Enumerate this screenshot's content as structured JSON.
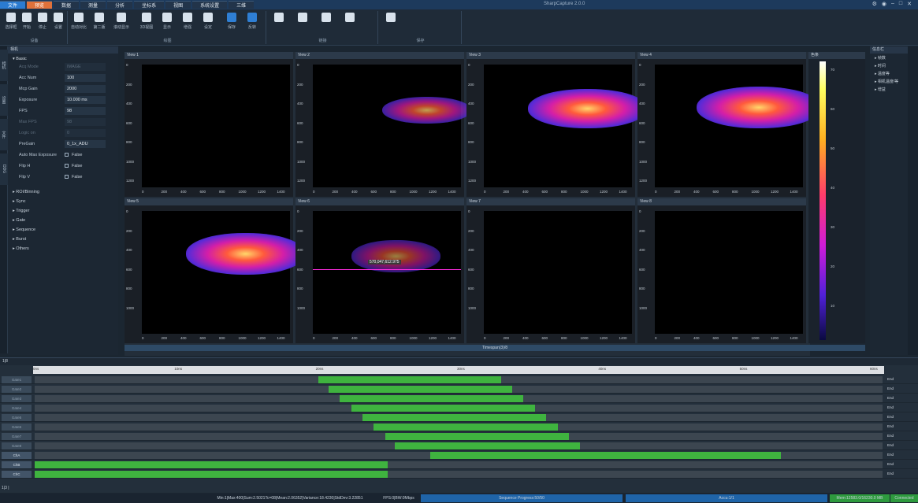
{
  "title_bar": {
    "tabs": [
      "文件",
      "预览",
      "数据",
      "测量",
      "分析",
      "坐标系",
      "视图",
      "系统设置",
      "三维"
    ],
    "app_title": "SharpCapture 2.0.0"
  },
  "ribbon": {
    "buttons": [
      "选择框",
      "开始",
      "停止",
      "设置",
      "自动对比",
      "第二版",
      "滚动显示",
      "3D视图",
      "显示",
      "增强",
      "设定",
      "保存",
      "反转"
    ],
    "groups": [
      "设备",
      "绘图",
      "链接",
      "保存"
    ]
  },
  "left_panel": {
    "header": "相机",
    "section": "Basic",
    "props": [
      {
        "key": "Acq Mode",
        "val": "IMAGE",
        "dim": true
      },
      {
        "key": "Acc Num",
        "val": "100",
        "dim": false
      },
      {
        "key": "Mcp Gain",
        "val": "2000",
        "dim": false
      },
      {
        "key": "Exposure",
        "val": "10.000  ms",
        "dim": false
      },
      {
        "key": "FPS",
        "val": "98",
        "dim": false
      },
      {
        "key": "Max FPS",
        "val": "98",
        "dim": true
      },
      {
        "key": "Logic on",
        "val": "0",
        "dim": true
      },
      {
        "key": "PreGain",
        "val": "0_1x_ADU",
        "dim": false
      }
    ],
    "checks": [
      {
        "key": "Auto Max Exposure",
        "val": "False"
      },
      {
        "key": "Flip H",
        "val": "False"
      },
      {
        "key": "Flip V",
        "val": "False"
      }
    ],
    "collapsed": [
      "ROI/Binning",
      "Sync",
      "Trigger",
      "Gate",
      "Sequence",
      "Burst",
      "Others"
    ]
  },
  "views": {
    "names": [
      "View 1",
      "View 2",
      "View 3",
      "View 4",
      "View 5",
      "View 6",
      "View 7",
      "View 8"
    ],
    "yticks": [
      "0",
      "200",
      "400",
      "600",
      "800",
      "1000",
      "1200"
    ],
    "xticks": [
      "0",
      "200",
      "400",
      "600",
      "800",
      "1000",
      "1200",
      "1400"
    ],
    "crosshair_label": "570,047,612.975",
    "slider_label": "Timespan(3)/8"
  },
  "colorbar": {
    "title": "色条",
    "ticks": [
      "70",
      "60",
      "50",
      "40",
      "30",
      "20",
      "10"
    ]
  },
  "right_panel": {
    "header": "信息栏",
    "items": [
      "帧数",
      "时间",
      "温度等",
      "相机温度/等",
      "增益"
    ]
  },
  "timeline": {
    "header": "1|8",
    "ruler": [
      "0ns",
      "10ns",
      "20ns",
      "30ns",
      "40ns",
      "50ns",
      "60ns"
    ],
    "channels": [
      {
        "name": "Gate1",
        "start": 20.1,
        "end": 33.0,
        "end_label": "End"
      },
      {
        "name": "Gate2",
        "start": 20.8,
        "end": 33.8,
        "end_label": "End"
      },
      {
        "name": "Gate3",
        "start": 21.6,
        "end": 34.6,
        "end_label": "End"
      },
      {
        "name": "Gate4",
        "start": 22.4,
        "end": 35.4,
        "end_label": "End"
      },
      {
        "name": "Gate5",
        "start": 23.2,
        "end": 36.2,
        "end_label": "End"
      },
      {
        "name": "Gate6",
        "start": 24.0,
        "end": 37.0,
        "end_label": "End"
      },
      {
        "name": "Gate7",
        "start": 24.8,
        "end": 37.8,
        "end_label": "End"
      },
      {
        "name": "Gate8",
        "start": 25.5,
        "end": 38.6,
        "end_label": "End"
      },
      {
        "name": "ChA",
        "start": 28.0,
        "end": 52.8,
        "end_label": "End"
      },
      {
        "name": "ChB",
        "start": 0.0,
        "end": 25.0,
        "end_label": "End"
      },
      {
        "name": "ChC",
        "start": 0.0,
        "end": 25.0,
        "end_label": "End"
      }
    ],
    "footer": "1|3 |"
  },
  "status": {
    "stats": "Min:1|Max:400|Sum:2.5021Tc=08|Mean:2.06352|Variance:18.4230|StdDev:3.22851",
    "fps": "FPS:0|BW:0Mbps",
    "progress": "Sequence Progress:50/50",
    "accu": "Accu:1/1",
    "mem": "Mem:12583.0/16230.0 MB",
    "conn": "Connected"
  },
  "colors": {
    "accent": "#2b7bd1",
    "active_tab": "#e0713a",
    "bar_green": "#3fb33f",
    "status_blue": "#1f64a8",
    "connected_green": "#2e9a3e"
  }
}
